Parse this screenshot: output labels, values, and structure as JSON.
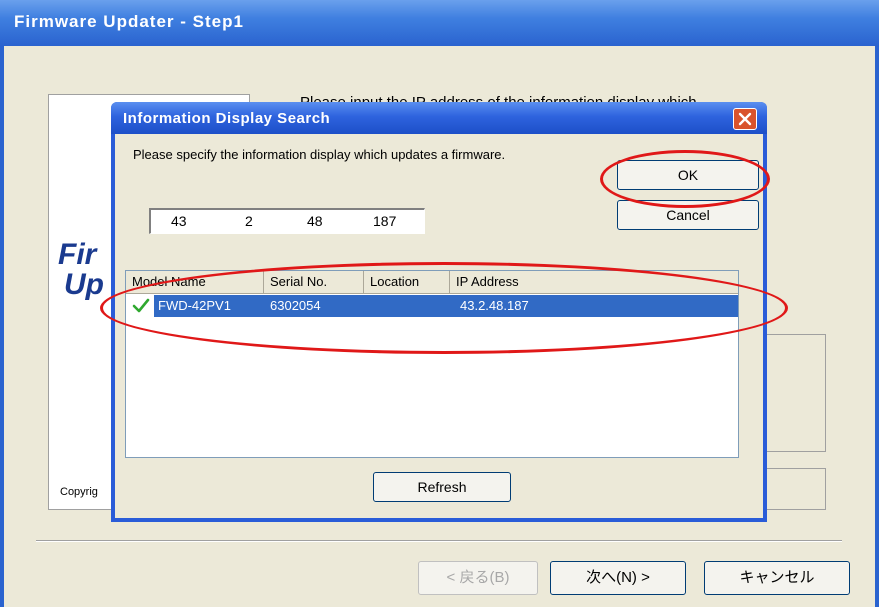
{
  "wizard": {
    "title": "Firmware Updater - Step1",
    "instruction": "Please input the IP address of the information display which",
    "logo_line1": "Fir",
    "logo_line2": "Up",
    "copyright": "Copyrig",
    "back_button": "< 戻る(B)",
    "next_button": "次へ(N) >",
    "cancel_button": "キャンセル"
  },
  "dialog": {
    "title": "Information Display Search",
    "prompt": "Please specify the information display which updates a firmware.",
    "ip_octets": [
      "43",
      "2",
      "48",
      "187"
    ],
    "ok_button": "OK",
    "cancel_button": "Cancel",
    "refresh_button": "Refresh",
    "columns": [
      "Model Name",
      "Serial No.",
      "Location",
      "IP Address"
    ],
    "rows": [
      {
        "checked": true,
        "model": "FWD-42PV1",
        "serial": "6302054",
        "location": "",
        "ip": "43.2.48.187"
      }
    ]
  },
  "colors": {
    "titlebar": "#2a63cf",
    "selection": "#316ac5",
    "highlight_annotation": "#e01818",
    "close_button": "#d9532c"
  },
  "icons": [
    "close-icon",
    "checkmark-icon"
  ]
}
